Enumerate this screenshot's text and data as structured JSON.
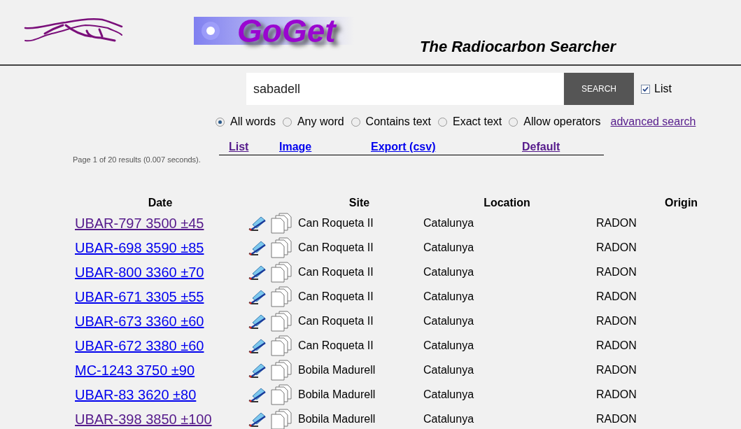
{
  "header": {
    "logo_text": "GoGet",
    "subtitle": "The Radiocarbon Searcher"
  },
  "search": {
    "value": "sabadell",
    "button": "SEARCH",
    "list_option": {
      "label": "List",
      "checked": true
    }
  },
  "match_modes": [
    {
      "label": "All words",
      "selected": true
    },
    {
      "label": "Any word",
      "selected": false
    },
    {
      "label": "Contains text",
      "selected": false
    },
    {
      "label": "Exact text",
      "selected": false
    },
    {
      "label": "Allow operators",
      "selected": false
    }
  ],
  "advanced_link": {
    "label": "advanced search",
    "visited": true
  },
  "view_links": [
    {
      "label": "List",
      "visited": true
    },
    {
      "label": "Image",
      "visited": false
    },
    {
      "label": "Export (csv)",
      "visited": false
    },
    {
      "label": "Default",
      "visited": true
    }
  ],
  "result_info": "Page 1  of  20 results (0.007 seconds).",
  "table": {
    "columns": [
      "Date",
      "Site",
      "Location",
      "Origin"
    ],
    "rows": [
      {
        "date": "UBAR-797 3500 ±45",
        "visited": true,
        "site": "Can Roqueta II",
        "location": "Catalunya",
        "origin": "RADON"
      },
      {
        "date": "UBAR-698 3590 ±85",
        "visited": false,
        "site": "Can Roqueta II",
        "location": "Catalunya",
        "origin": "RADON"
      },
      {
        "date": "UBAR-800 3360 ±70",
        "visited": false,
        "site": "Can Roqueta II",
        "location": "Catalunya",
        "origin": "RADON"
      },
      {
        "date": "UBAR-671 3305 ±55",
        "visited": false,
        "site": "Can Roqueta II",
        "location": "Catalunya",
        "origin": "RADON"
      },
      {
        "date": "UBAR-673 3360 ±60",
        "visited": false,
        "site": "Can Roqueta II",
        "location": "Catalunya",
        "origin": "RADON"
      },
      {
        "date": "UBAR-672 3380 ±60",
        "visited": false,
        "site": "Can Roqueta II",
        "location": "Catalunya",
        "origin": "RADON"
      },
      {
        "date": "MC-1243 3750 ±90",
        "visited": false,
        "site": "Bobila Madurell",
        "location": "Catalunya",
        "origin": "RADON"
      },
      {
        "date": "UBAR-83 3620 ±80",
        "visited": false,
        "site": "Bobila Madurell",
        "location": "Catalunya",
        "origin": "RADON"
      },
      {
        "date": "UBAR-398 3850 ±100",
        "visited": true,
        "site": "Bobila Madurell",
        "location": "Catalunya",
        "origin": "RADON"
      }
    ]
  }
}
